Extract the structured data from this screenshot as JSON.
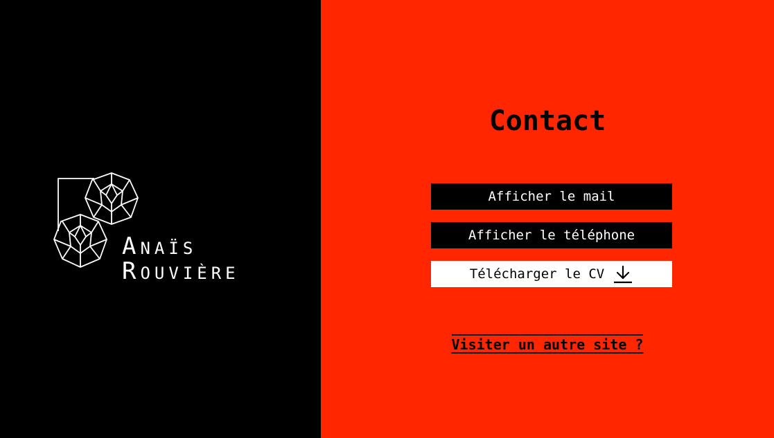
{
  "brand": {
    "name_line1": "Anaïs",
    "name_line2": "Rouvière",
    "logo_icon": "geometric-pentagon-tiling-icon"
  },
  "colors": {
    "left_background": "#000000",
    "right_background": "#ff2600",
    "text_light": "#ffffff",
    "text_dark": "#000000"
  },
  "contact": {
    "title": "Contact",
    "show_mail_label": "Afficher le mail",
    "show_phone_label": "Afficher le téléphone",
    "download_cv_label": "Télécharger le CV",
    "download_icon": "download-arrow-icon",
    "other_site_link": "Visiter un autre site ?"
  }
}
